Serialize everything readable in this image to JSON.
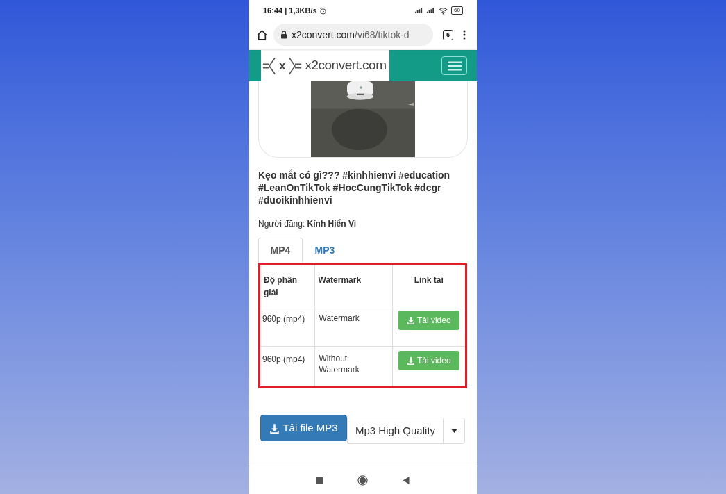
{
  "status_bar": {
    "time": "16:44 | 1,3KB/s",
    "battery": "60"
  },
  "browser": {
    "url_host": "x2convert.com",
    "url_path": "/vi68/tiktok-d",
    "tab_count": "6"
  },
  "site_header": {
    "logo_mark": "x",
    "logo_text": "x2convert.com"
  },
  "video": {
    "title": "Kẹo mắt có gì??? #kinhhienvi #education #LeanOnTikTok #HocCungTikTok #dcgr #duoikinhhienvi",
    "author_label": "Người đăng:",
    "author": "Kính Hiển Vi"
  },
  "tabs": [
    {
      "label": "MP4",
      "selected": true
    },
    {
      "label": "MP3",
      "selected": false
    }
  ],
  "table": {
    "columns": [
      "Độ phân giải",
      "Watermark",
      "Link tải"
    ],
    "rows": [
      {
        "resolution": "960p (mp4)",
        "watermark": "Watermark",
        "button": "Tải video"
      },
      {
        "resolution": "960p (mp4)",
        "watermark": "Without Watermark",
        "button": "Tải video"
      }
    ]
  },
  "mp3": {
    "button": "Tải file MP3",
    "quality": "Mp3 High Quality"
  }
}
